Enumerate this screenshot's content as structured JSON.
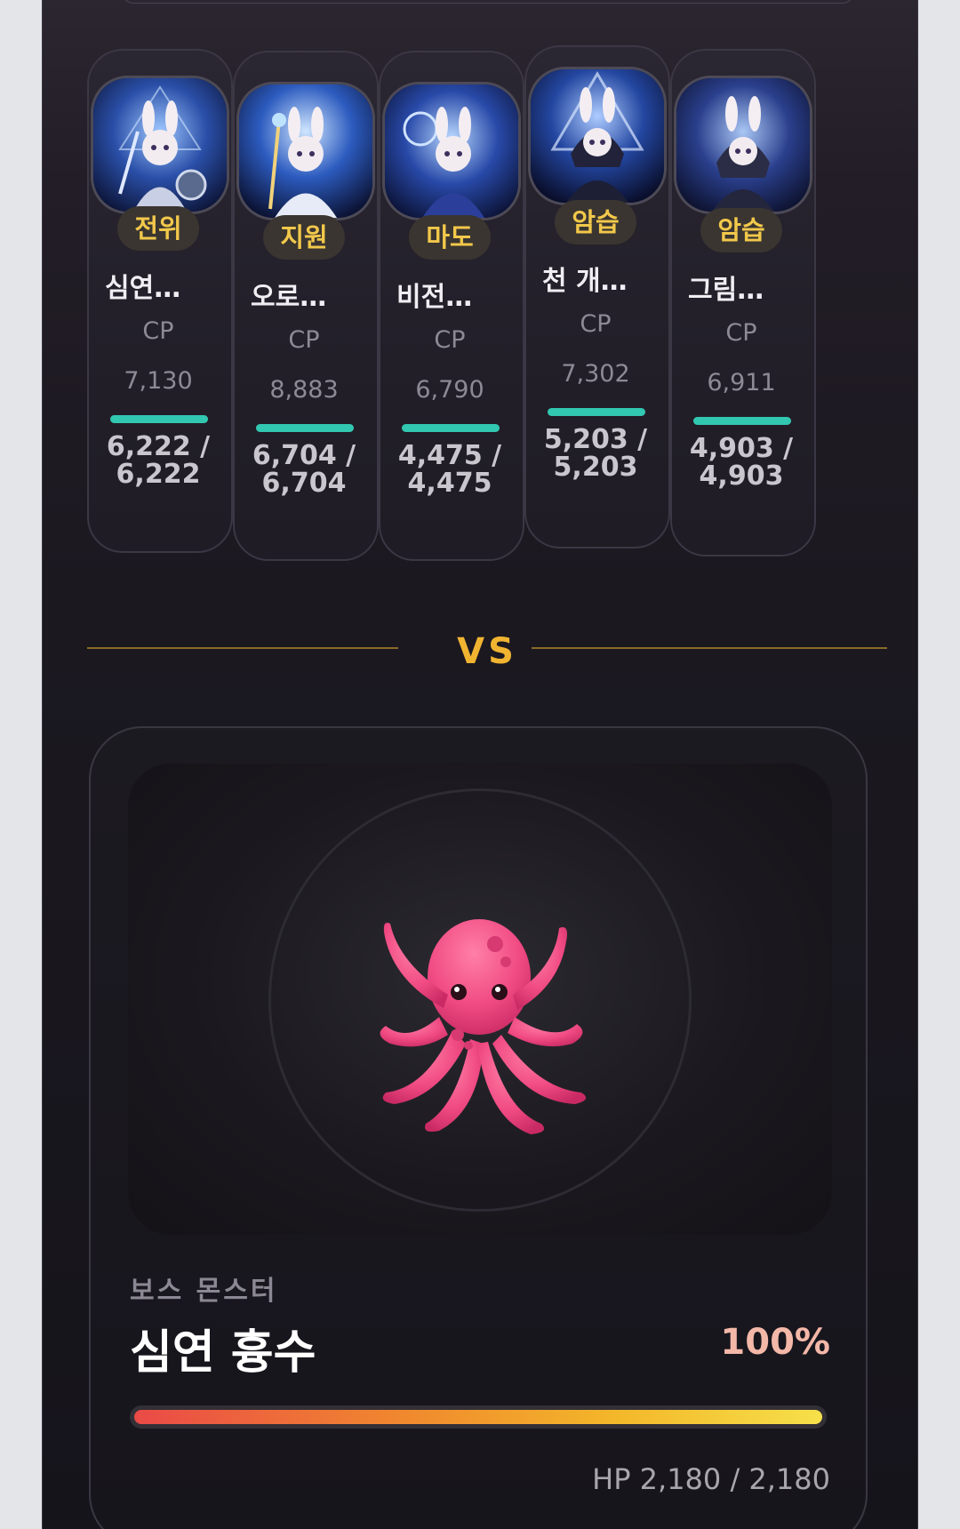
{
  "team": [
    {
      "role": "전위",
      "name": "심연…",
      "cp_label": "CP",
      "cp": "7,130",
      "hp_text": "6,222 /\n6,222",
      "hp_fill": 1.0
    },
    {
      "role": "지원",
      "name": "오로…",
      "cp_label": "CP",
      "cp": "8,883",
      "hp_text": "6,704 /\n6,704",
      "hp_fill": 1.0
    },
    {
      "role": "마도",
      "name": "비전…",
      "cp_label": "CP",
      "cp": "6,790",
      "hp_text": "4,475 /\n4,475",
      "hp_fill": 1.0
    },
    {
      "role": "암습",
      "name": "천 개…",
      "cp_label": "CP",
      "cp": "7,302",
      "hp_text": "5,203 /\n5,203",
      "hp_fill": 1.0
    },
    {
      "role": "암습",
      "name": "그림…",
      "cp_label": "CP",
      "cp": "6,911",
      "hp_text": "4,903 /\n4,903",
      "hp_fill": 1.0
    }
  ],
  "vs_label": "VS",
  "boss": {
    "subtitle": "보스 몬스터",
    "name": "심연 흉수",
    "hp_percent": "100%",
    "hp_fill": 1.0,
    "hp_text": "HP 2,180 / 2,180",
    "icon": "octopus-icon"
  },
  "colors": {
    "role_badge_text": "#f2c84b",
    "team_hp_fill": "#32c7b0",
    "vs": "#f0b431",
    "boss_pct": "#f4b8a8"
  }
}
